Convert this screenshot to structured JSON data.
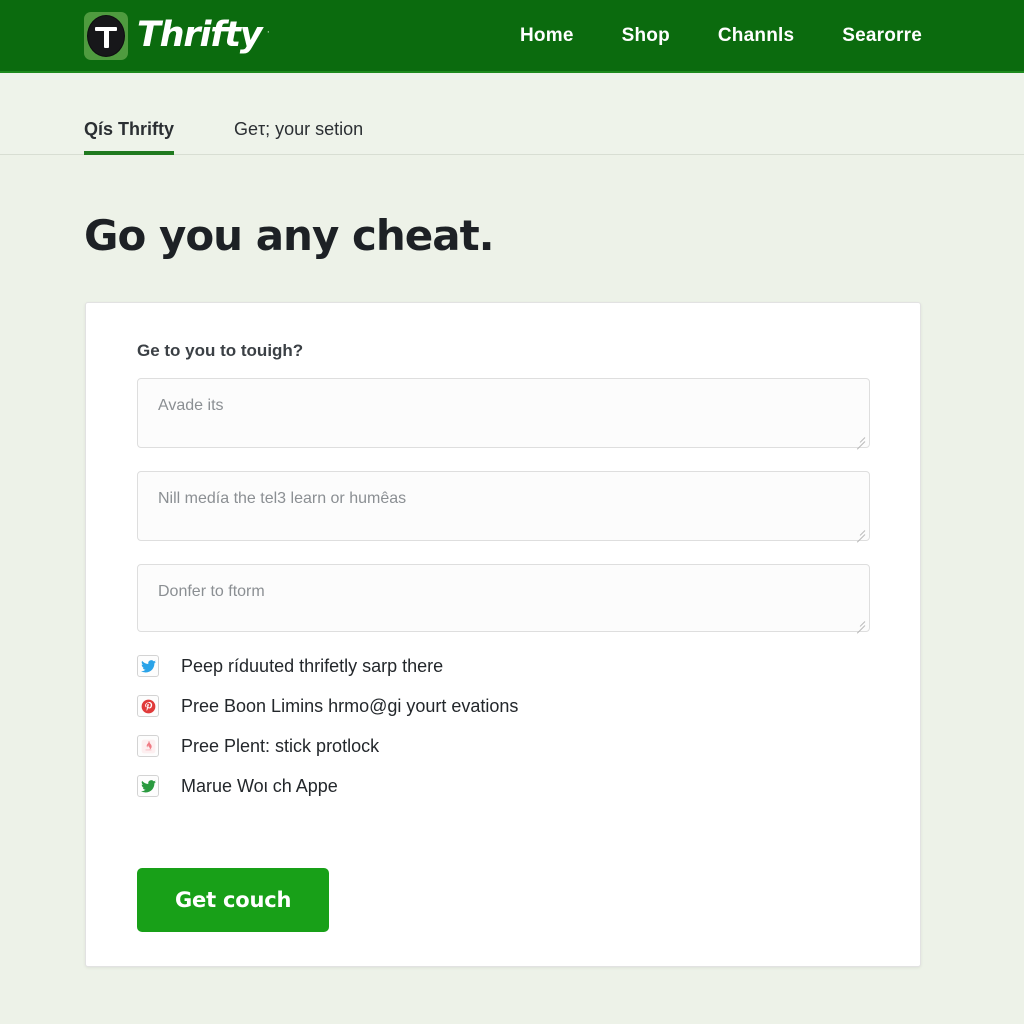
{
  "colors": {
    "header_green": "#0b6b0e",
    "accent_green": "#1f7a1f",
    "button_green": "#18a018",
    "page_background": "#edf2e8",
    "card_background": "#ffffff"
  },
  "header": {
    "brand_name": "Thrifty",
    "brand_tm": "·",
    "logo_icon": "thrifty-circle-t-logo",
    "nav": [
      {
        "label": "Home",
        "name": "nav-link-home"
      },
      {
        "label": "Shop",
        "name": "nav-link-shop"
      },
      {
        "label": "Channls",
        "name": "nav-link-channls"
      },
      {
        "label": "Searorre",
        "name": "nav-link-searorre"
      }
    ]
  },
  "tabs": [
    {
      "label": "Qís Thrifty",
      "active": true
    },
    {
      "label": "Geτ; your setion",
      "active": false
    }
  ],
  "main": {
    "title": "Go you any cheat.",
    "form": {
      "label": "Ge to you to touigh?",
      "fields": [
        {
          "placeholder": "Avade its",
          "value": ""
        },
        {
          "placeholder": "Nill medía the tel3 learn or humêas",
          "value": ""
        },
        {
          "placeholder": "Donfer to ftorm",
          "value": ""
        }
      ],
      "options": [
        {
          "text": "Peep ríduuted thrifetly sarp there",
          "icon": "twitter-bird-blue-icon",
          "icon_color": "#2aa3e8"
        },
        {
          "text": "Pree Boon Limins hrmo@gi yourt evations",
          "icon": "pinterest-circle-red-icon",
          "icon_color": "#e03a3a"
        },
        {
          "text": "Pree Plent: stick protlock",
          "icon": "flame-badge-pink-icon",
          "icon_color": "#ef7b84"
        },
        {
          "text": "Marue Woι ch Appe",
          "icon": "twitter-bird-green-icon",
          "icon_color": "#2a9a3f"
        }
      ],
      "submit_label": "Get couch"
    }
  }
}
